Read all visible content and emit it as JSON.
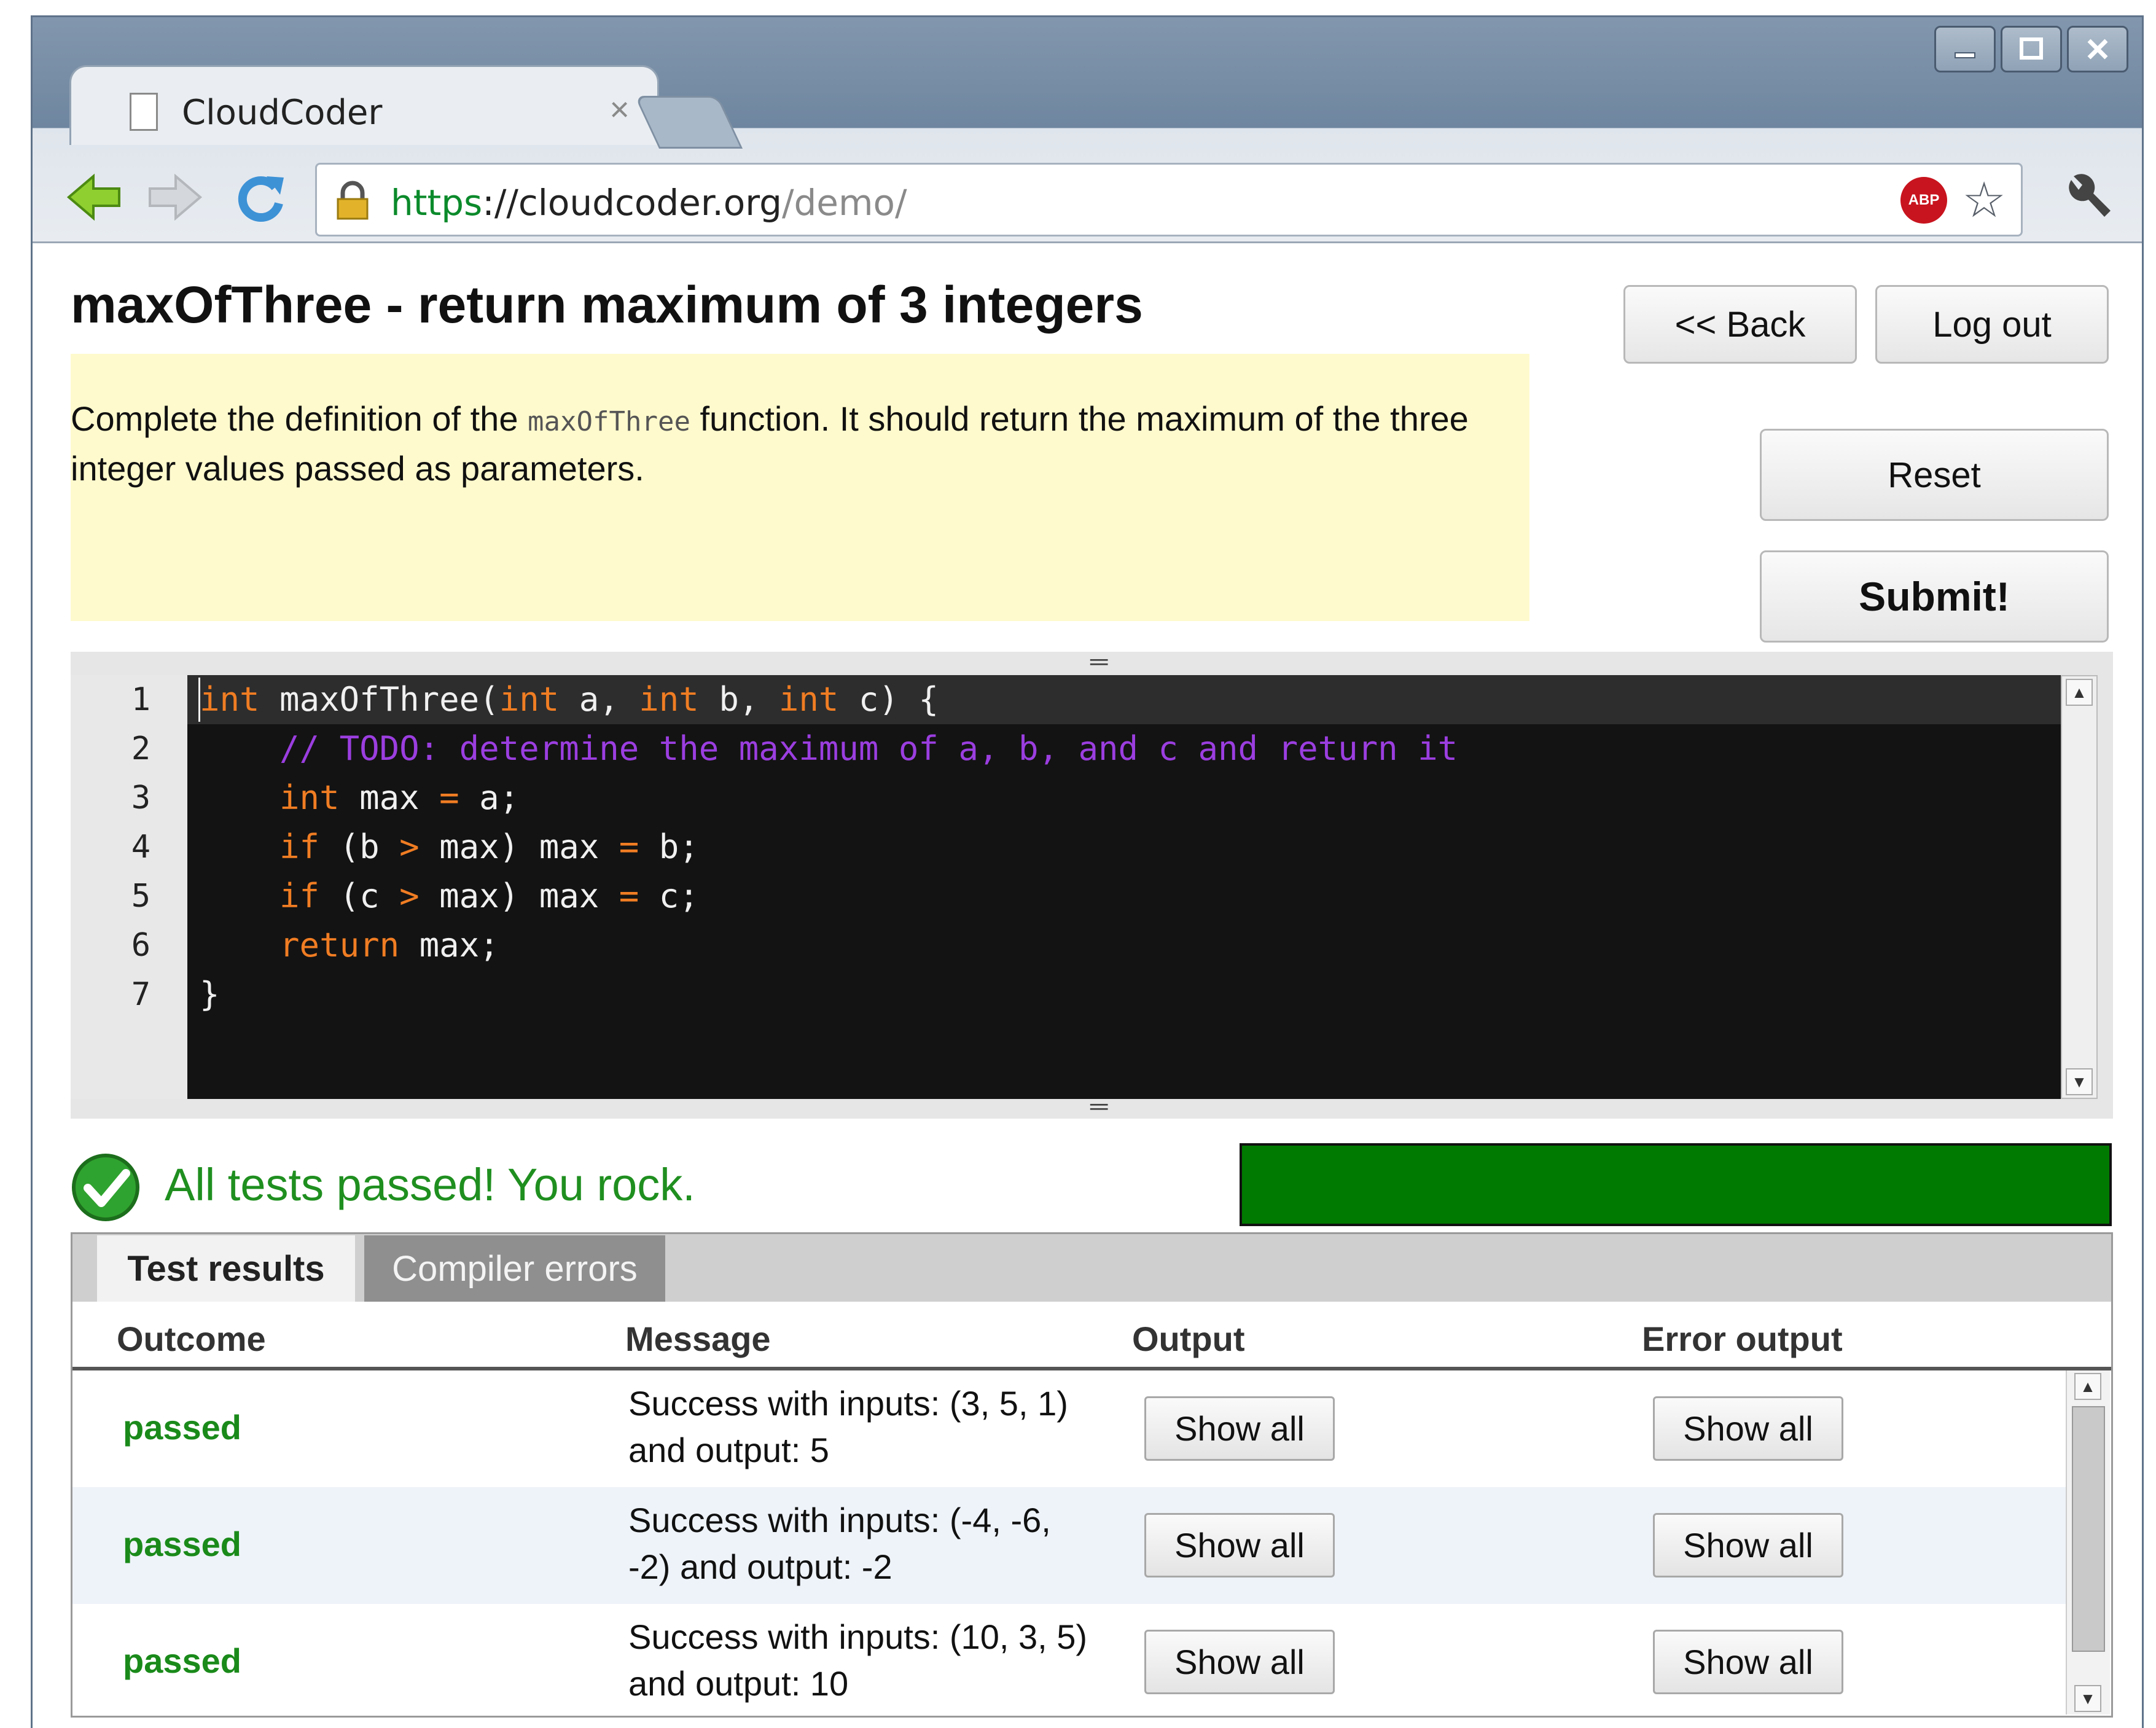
{
  "browser": {
    "tab_title": "CloudCoder",
    "tab_close": "×",
    "url_scheme": "https",
    "url_sep": "://",
    "url_host": "cloudcoder.org",
    "url_path": "/demo/",
    "abp_label": "ABP"
  },
  "page": {
    "title": "maxOfThree - return maximum of 3 integers",
    "back_label": "<< Back",
    "logout_label": "Log out",
    "reset_label": "Reset",
    "submit_label": "Submit!",
    "desc_before": "Complete the definition of the ",
    "desc_code": "maxOfThree",
    "desc_after": " function. It should return the maximum of the three integer values passed as parameters."
  },
  "editor": {
    "line_numbers": [
      "1",
      "2",
      "3",
      "4",
      "5",
      "6",
      "7"
    ],
    "line1": {
      "kw1": "int",
      "t1": " maxOfThree(",
      "kw2": "int",
      "t2": " a, ",
      "kw3": "int",
      "t3": " b, ",
      "kw4": "int",
      "t4": " c) {"
    },
    "line2": {
      "comment": "    // TODO: determine the maximum of a, b, and c and return it"
    },
    "line3": {
      "indent": "    ",
      "kw": "int",
      "t1": " max ",
      "op": "=",
      "t2": " a;"
    },
    "line4": {
      "indent": "    ",
      "kw": "if",
      "t1": " (b ",
      "op1": ">",
      "t2": " max) max ",
      "op2": "=",
      "t3": " b;"
    },
    "line5": {
      "indent": "    ",
      "kw": "if",
      "t1": " (c ",
      "op1": ">",
      "t2": " max) max ",
      "op2": "=",
      "t3": " c;"
    },
    "line6": {
      "indent": "    ",
      "kw": "return",
      "t1": " max;"
    },
    "line7": {
      "t1": "}"
    }
  },
  "status": {
    "message": "All tests passed! You rock.",
    "progress_fraction": 1.0,
    "progress_color": "#007a00"
  },
  "results": {
    "tabs": [
      "Test results",
      "Compiler errors"
    ],
    "columns": [
      "Outcome",
      "Message",
      "Output",
      "Error output"
    ],
    "rows": [
      {
        "outcome": "passed",
        "message": "Success with inputs: (3, 5, 1) and output: 5",
        "output_btn": "Show all",
        "error_btn": "Show all"
      },
      {
        "outcome": "passed",
        "message": "Success with inputs: (-4, -6, -2) and output: -2",
        "output_btn": "Show all",
        "error_btn": "Show all"
      },
      {
        "outcome": "passed",
        "message": "Success with inputs: (10, 3, 5) and output: 10",
        "output_btn": "Show all",
        "error_btn": "Show all"
      }
    ]
  },
  "colors": {
    "keyword": "#f07d23",
    "comment": "#9b3ee0",
    "passed": "#1a8a1a",
    "description_bg": "#fffacd"
  }
}
